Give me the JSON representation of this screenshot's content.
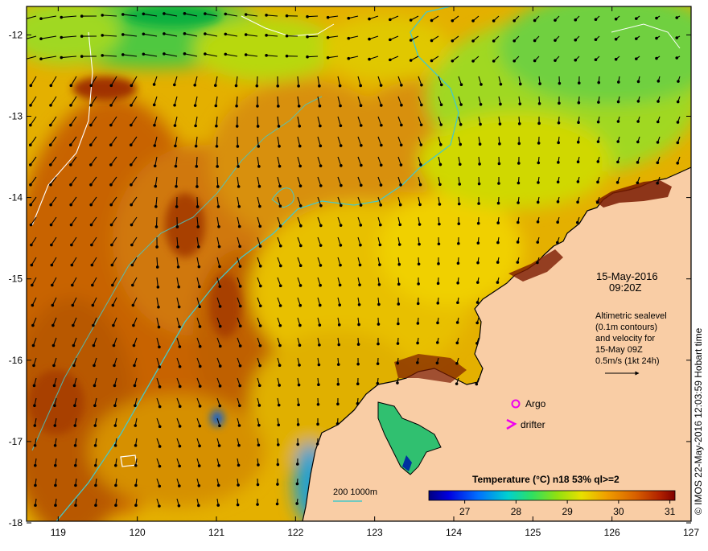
{
  "map": {
    "date_line": "15-May-2016",
    "time_line": "09:20Z",
    "info_lines": [
      "Altimetric sealevel",
      "(0.1m contours)",
      "and velocity for",
      "15-May 09Z",
      "0.5m/s (1kt 24h)"
    ],
    "legend_argo": "Argo",
    "legend_drifter": "drifter",
    "isobath_label": "200  1000m",
    "colorbar_title": "Temperature (°C) n18 53% ql>=2",
    "colorbar_ticks": [
      "27",
      "28",
      "29",
      "30",
      "31"
    ],
    "credit": "© IMOS 22-May-2016 12:03:59 Hobart time",
    "x_ticks": [
      "119",
      "120",
      "121",
      "122",
      "123",
      "124",
      "125",
      "126",
      "127"
    ],
    "y_ticks": [
      "-12",
      "-13",
      "-14",
      "-15",
      "-16",
      "-17",
      "-18"
    ],
    "colors": {
      "land": "#f9cda5",
      "coast": "#000000",
      "isobath": "#46c8c8",
      "contour": "#ffffff",
      "marker": "#ee00ee"
    }
  }
}
